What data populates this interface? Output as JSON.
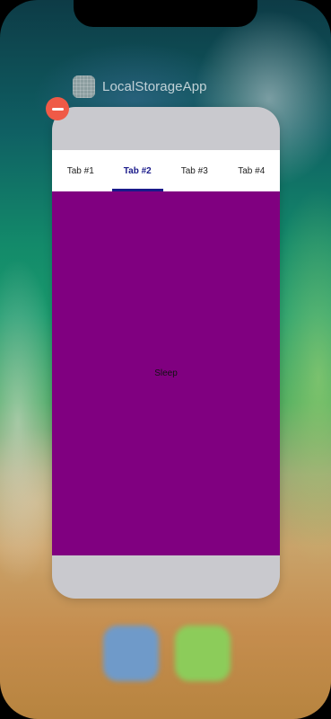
{
  "switcher": {
    "app_name": "LocalStorageApp",
    "app_icon": "app-icon-grid",
    "close_icon": "minus-circle-icon",
    "close_color": "#ef5a47"
  },
  "tabs": [
    {
      "label": "Tab #1",
      "active": false
    },
    {
      "label": "Tab #2",
      "active": true
    },
    {
      "label": "Tab #3",
      "active": false
    },
    {
      "label": "Tab #4",
      "active": false
    }
  ],
  "content": {
    "text": "Sleep",
    "background": "#800080"
  },
  "colors": {
    "active_tab": "#1a1a8a",
    "card_background": "#c9c9ce"
  }
}
